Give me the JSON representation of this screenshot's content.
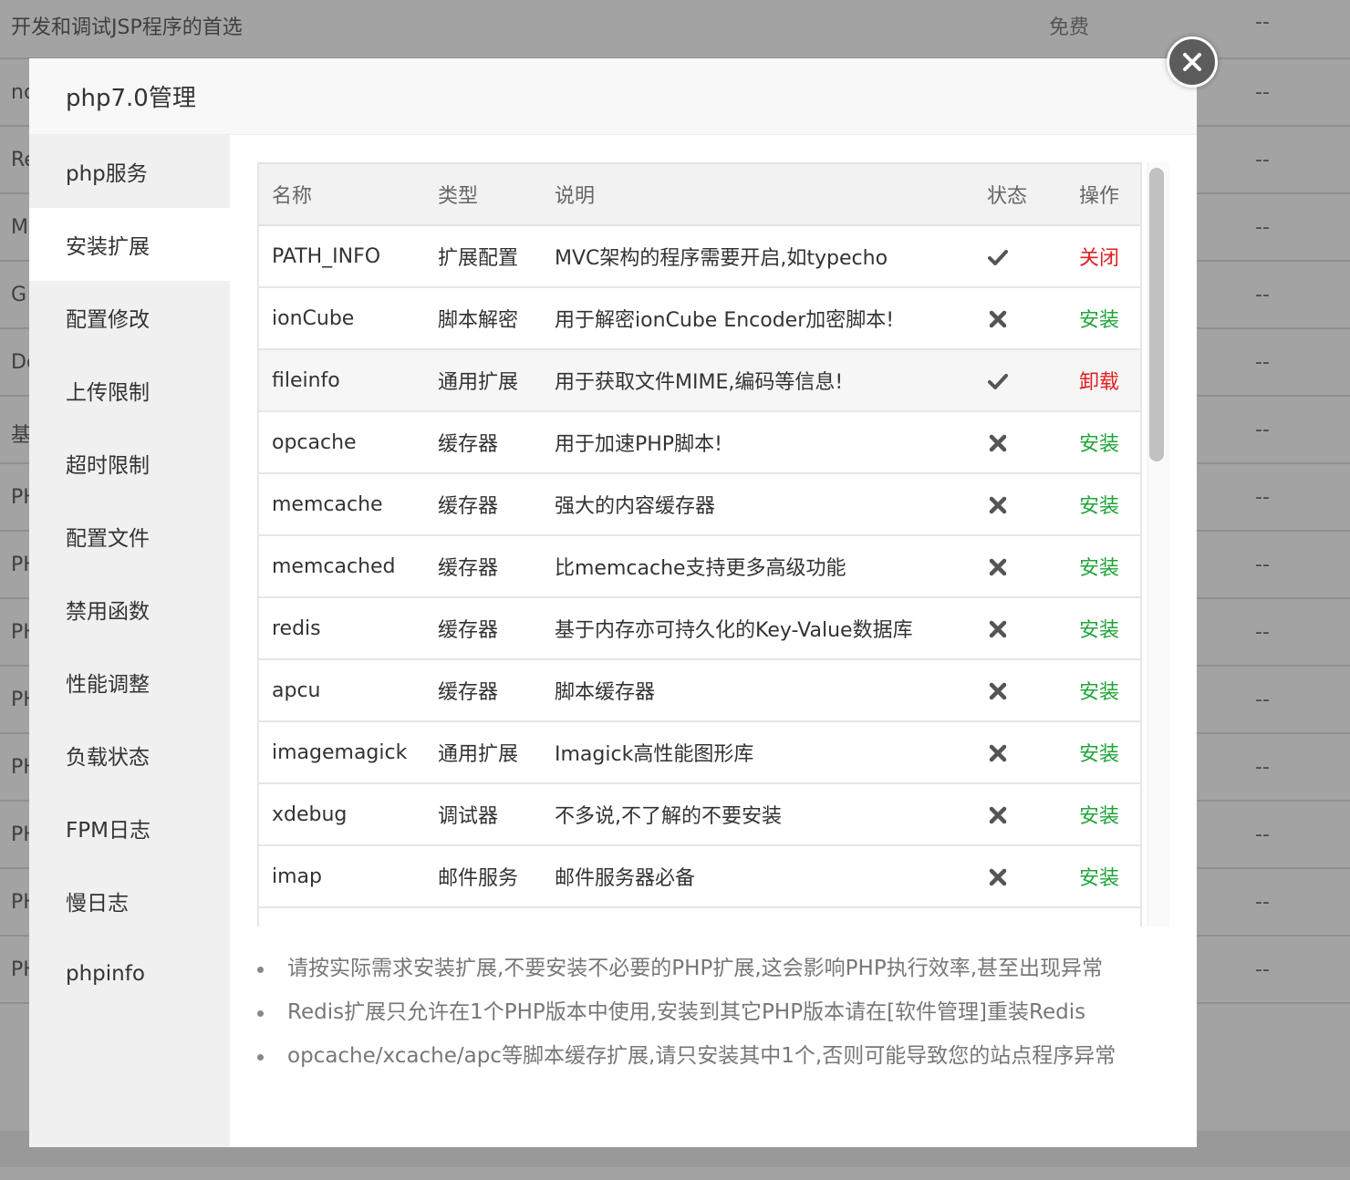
{
  "background": {
    "rows": [
      {
        "first": "开发和调试JSP程序的首选",
        "price": "免费",
        "op": "--"
      },
      {
        "first": "nc",
        "price": "",
        "op": "--"
      },
      {
        "first": "Re",
        "price": "",
        "op": "--"
      },
      {
        "first": "M",
        "price": "",
        "op": "--"
      },
      {
        "first": "G",
        "price": "",
        "op": "--"
      },
      {
        "first": "Do",
        "price": "",
        "op": "--"
      },
      {
        "first": "基",
        "price": "",
        "op": "--"
      },
      {
        "first": "PH",
        "price": "",
        "op": "--"
      },
      {
        "first": "PH",
        "price": "",
        "op": "--"
      },
      {
        "first": "PH",
        "price": "",
        "op": "--"
      },
      {
        "first": "PH",
        "price": "",
        "op": "--"
      },
      {
        "first": "PH",
        "price": "",
        "op": "--"
      },
      {
        "first": "PH",
        "price": "",
        "op": "--"
      },
      {
        "first": "PH",
        "price": "",
        "op": "--"
      },
      {
        "first": "PH",
        "price": "",
        "op": "--"
      }
    ]
  },
  "modal": {
    "title": "php7.0管理",
    "close_icon": "close-icon"
  },
  "sidebar": {
    "items": [
      {
        "label": "php服务",
        "active": false
      },
      {
        "label": "安装扩展",
        "active": true
      },
      {
        "label": "配置修改",
        "active": false
      },
      {
        "label": "上传限制",
        "active": false
      },
      {
        "label": "超时限制",
        "active": false
      },
      {
        "label": "配置文件",
        "active": false
      },
      {
        "label": "禁用函数",
        "active": false
      },
      {
        "label": "性能调整",
        "active": false
      },
      {
        "label": "负载状态",
        "active": false
      },
      {
        "label": "FPM日志",
        "active": false
      },
      {
        "label": "慢日志",
        "active": false
      },
      {
        "label": "phpinfo",
        "active": false
      }
    ]
  },
  "table": {
    "headers": {
      "name": "名称",
      "type": "类型",
      "desc": "说明",
      "status": "状态",
      "op": "操作"
    },
    "rows": [
      {
        "name": "PATH_INFO",
        "type": "扩展配置",
        "desc": "MVC架构的程序需要开启,如typecho",
        "status": "check",
        "op": "关闭",
        "op_color": "#e02020",
        "highlight": false
      },
      {
        "name": "ionCube",
        "type": "脚本解密",
        "desc": "用于解密ionCube Encoder加密脚本!",
        "status": "cross",
        "op": "安装",
        "op_color": "#20a53a",
        "highlight": false
      },
      {
        "name": "fileinfo",
        "type": "通用扩展",
        "desc": "用于获取文件MIME,编码等信息!",
        "status": "check",
        "op": "卸载",
        "op_color": "#e02020",
        "highlight": true
      },
      {
        "name": "opcache",
        "type": "缓存器",
        "desc": "用于加速PHP脚本!",
        "status": "cross",
        "op": "安装",
        "op_color": "#20a53a",
        "highlight": false
      },
      {
        "name": "memcache",
        "type": "缓存器",
        "desc": "强大的内容缓存器",
        "status": "cross",
        "op": "安装",
        "op_color": "#20a53a",
        "highlight": false
      },
      {
        "name": "memcached",
        "type": "缓存器",
        "desc": "比memcache支持更多高级功能",
        "status": "cross",
        "op": "安装",
        "op_color": "#20a53a",
        "highlight": false
      },
      {
        "name": "redis",
        "type": "缓存器",
        "desc": "基于内存亦可持久化的Key-Value数据库",
        "status": "cross",
        "op": "安装",
        "op_color": "#20a53a",
        "highlight": false
      },
      {
        "name": "apcu",
        "type": "缓存器",
        "desc": "脚本缓存器",
        "status": "cross",
        "op": "安装",
        "op_color": "#20a53a",
        "highlight": false
      },
      {
        "name": "imagemagick",
        "type": "通用扩展",
        "desc": "Imagick高性能图形库",
        "status": "cross",
        "op": "安装",
        "op_color": "#20a53a",
        "highlight": false
      },
      {
        "name": "xdebug",
        "type": "调试器",
        "desc": "不多说,不了解的不要安装",
        "status": "cross",
        "op": "安装",
        "op_color": "#20a53a",
        "highlight": false
      },
      {
        "name": "imap",
        "type": "邮件服务",
        "desc": "邮件服务器必备",
        "status": "cross",
        "op": "安装",
        "op_color": "#20a53a",
        "highlight": false
      }
    ]
  },
  "notes": [
    "请按实际需求安装扩展,不要安装不必要的PHP扩展,这会影响PHP执行效率,甚至出现异常",
    "Redis扩展只允许在1个PHP版本中使用,安装到其它PHP版本请在[软件管理]重装Redis",
    "opcache/xcache/apc等脚本缓存扩展,请只安装其中1个,否则可能导致您的站点程序异常"
  ],
  "status_icons": {
    "check": "checkmark-icon",
    "cross": "cross-icon"
  }
}
